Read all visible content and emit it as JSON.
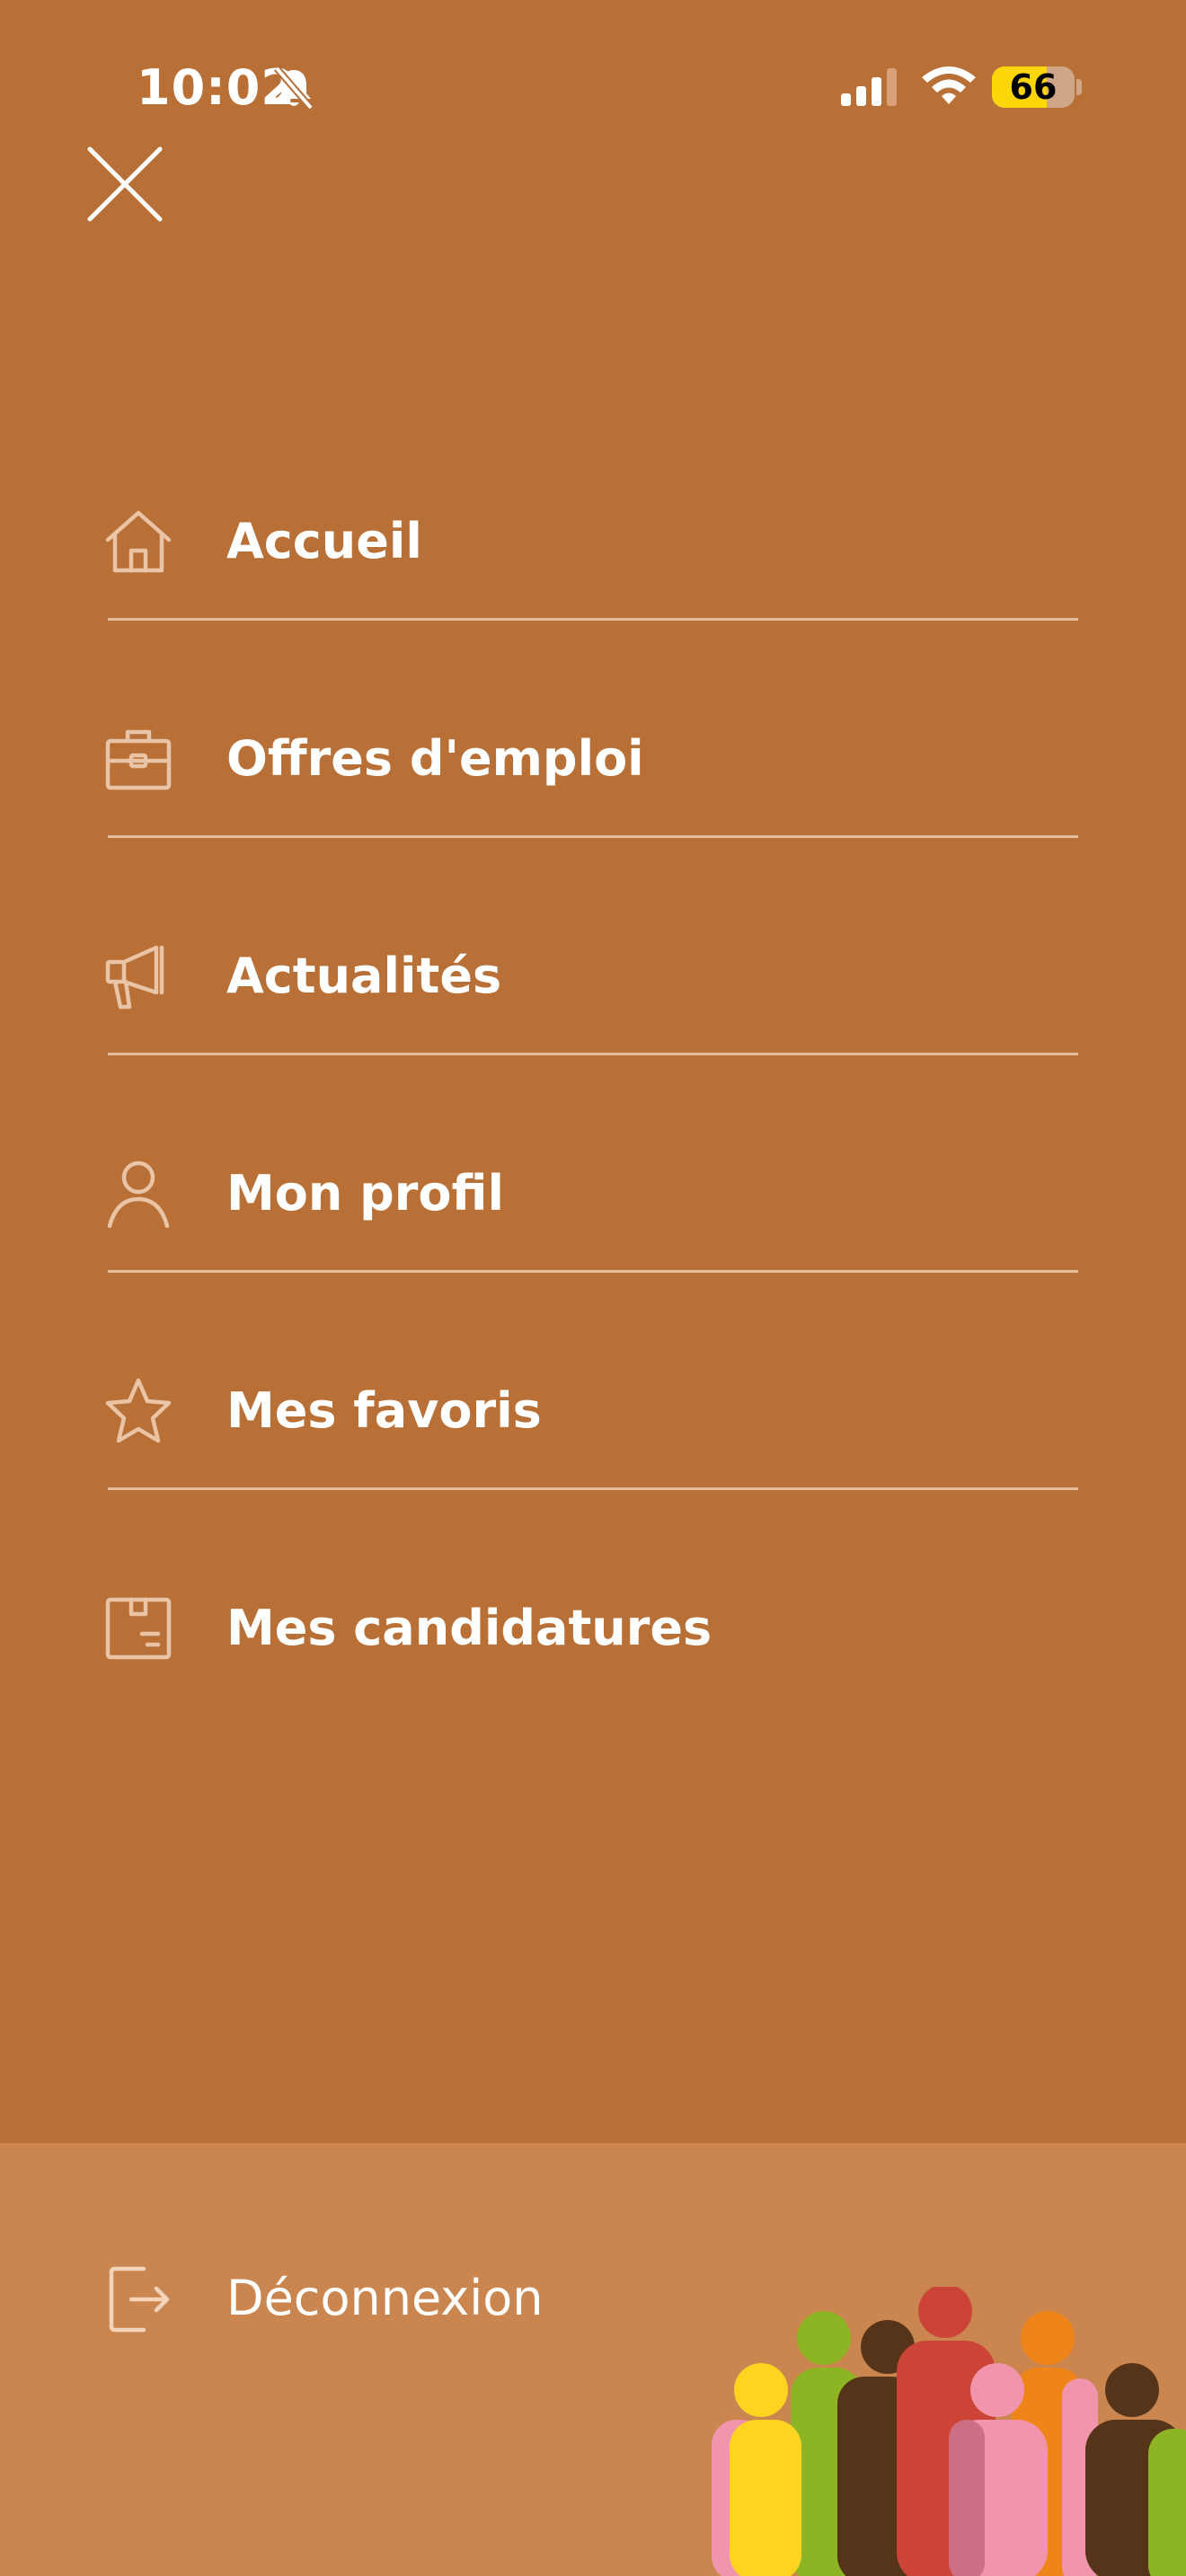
{
  "status_bar": {
    "time": "10:02",
    "battery_level": "66",
    "battery_fraction": 0.66,
    "icons": [
      "bell-muted-icon",
      "cellular-signal-icon",
      "wifi-icon",
      "battery-icon"
    ]
  },
  "colors": {
    "background": "#B87037",
    "footer_background": "#CB864F",
    "icon_tint": "#EAC4A6",
    "battery_accent": "#FFD60A"
  },
  "menu": {
    "close_icon": "close-icon",
    "items": [
      {
        "label": "Accueil",
        "icon": "home-icon"
      },
      {
        "label": "Offres d'emploi",
        "icon": "briefcase-icon"
      },
      {
        "label": "Actualités",
        "icon": "megaphone-icon"
      },
      {
        "label": "Mon profil",
        "icon": "user-icon"
      },
      {
        "label": "Mes favoris",
        "icon": "star-icon"
      },
      {
        "label": "Mes candidatures",
        "icon": "package-icon"
      }
    ]
  },
  "footer": {
    "logout_label": "Déconnexion",
    "logout_icon": "logout-icon",
    "illustration": "people-crowd-illustration"
  }
}
